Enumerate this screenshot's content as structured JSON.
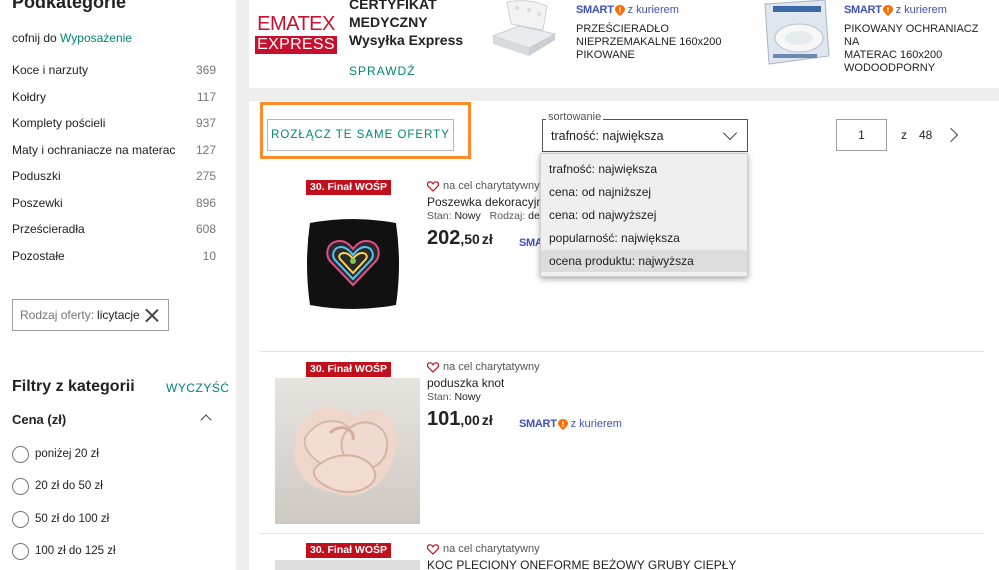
{
  "sidebar": {
    "title": "Podkategorie",
    "back_text": "cofnij do",
    "back_link": "Wyposażenie",
    "categories": [
      {
        "label": "Koce i narzuty",
        "count": "369"
      },
      {
        "label": "Kołdry",
        "count": "117"
      },
      {
        "label": "Komplety pościeli",
        "count": "937"
      },
      {
        "label": "Maty i ochraniacze na materac",
        "count": "127"
      },
      {
        "label": "Poduszki",
        "count": "275"
      },
      {
        "label": "Poszewki",
        "count": "896"
      },
      {
        "label": "Prześcieradła",
        "count": "608"
      },
      {
        "label": "Pozostałe",
        "count": "10"
      }
    ],
    "filter_chip": {
      "key": "Rodzaj oferty:",
      "value": "licytacje"
    },
    "filters_title": "Filtry z kategorii",
    "clear_label": "WYCZYŚĆ",
    "price_title": "Cena (zł)",
    "price_options": [
      "poniżej 20 zł",
      "20 zł do 50 zł",
      "50 zł do 100 zł",
      "100 zł do 125 zł"
    ]
  },
  "banner": {
    "logo_top": "EMATEX",
    "logo_bottom": "EXPRESS",
    "headline_lines": [
      "CERTYFIKAT",
      "MEDYCZNY",
      "Wysyłka Express"
    ],
    "cta": "SPRAWDŹ",
    "promos": [
      {
        "smart": "SMART",
        "smart_tail": "z kurierem",
        "lines": [
          "PRZEŚCIERADŁO",
          "NIEPRZEMAKALNE 160x200",
          "PIKOWANE"
        ]
      },
      {
        "smart": "SMART",
        "smart_tail": "z kurierem",
        "lines": [
          "PIKOWANY OCHRANIACZ NA",
          "MATERAC 160x200",
          "WODOODPORNY"
        ]
      }
    ]
  },
  "toolbar": {
    "disconnect_label": "ROZŁĄCZ TE SAME OFERTY",
    "sort_legend": "sortowanie",
    "sort_selected": "trafność: największa",
    "sort_options": [
      "trafność: największa",
      "cena: od najniższej",
      "cena: od najwyższej",
      "popularność: największa",
      "ocena produktu: najwyższa"
    ],
    "page_value": "1",
    "page_of": "z",
    "page_total": "48"
  },
  "products": [
    {
      "badge": "30. Finał WOŚP",
      "charity": "na cel charytatywny",
      "title": "Poszewka dekoracyjna",
      "condition_label": "Stan:",
      "condition": "Nowy",
      "kind_label": "Rodzaj:",
      "kind": "de",
      "price_main": "202",
      "price_cents": ",50",
      "currency": "zł",
      "smart": "SMART",
      "smart_tail": ""
    },
    {
      "badge": "30. Finał WOŚP",
      "charity": "na cel charytatywny",
      "title": "poduszka knot",
      "condition_label": "Stan:",
      "condition": "Nowy",
      "price_main": "101",
      "price_cents": ",00",
      "currency": "zł",
      "smart": "SMART",
      "smart_tail": "z kurierem"
    },
    {
      "badge": "30. Finał WOŚP",
      "charity": "na cel charytatywny",
      "title": "KOC PLECIONY ONEFORME BEŻOWY GRUBY CIEPŁY"
    }
  ],
  "colors": {
    "accent": "#008673",
    "highlight": "#ff8a2a",
    "badge": "#c20f1c",
    "smart": "#3f51b5"
  }
}
